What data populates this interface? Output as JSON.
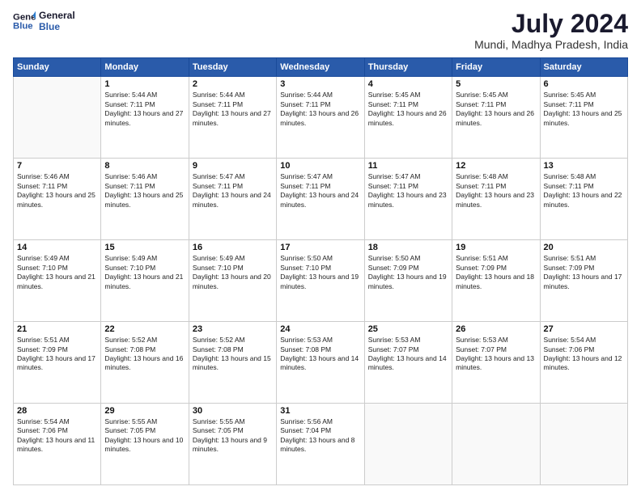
{
  "header": {
    "logo_line1": "General",
    "logo_line2": "Blue",
    "title": "July 2024",
    "subtitle": "Mundi, Madhya Pradesh, India"
  },
  "days_of_week": [
    "Sunday",
    "Monday",
    "Tuesday",
    "Wednesday",
    "Thursday",
    "Friday",
    "Saturday"
  ],
  "weeks": [
    [
      {
        "day": "",
        "sunrise": "",
        "sunset": "",
        "daylight": ""
      },
      {
        "day": "1",
        "sunrise": "Sunrise: 5:44 AM",
        "sunset": "Sunset: 7:11 PM",
        "daylight": "Daylight: 13 hours and 27 minutes."
      },
      {
        "day": "2",
        "sunrise": "Sunrise: 5:44 AM",
        "sunset": "Sunset: 7:11 PM",
        "daylight": "Daylight: 13 hours and 27 minutes."
      },
      {
        "day": "3",
        "sunrise": "Sunrise: 5:44 AM",
        "sunset": "Sunset: 7:11 PM",
        "daylight": "Daylight: 13 hours and 26 minutes."
      },
      {
        "day": "4",
        "sunrise": "Sunrise: 5:45 AM",
        "sunset": "Sunset: 7:11 PM",
        "daylight": "Daylight: 13 hours and 26 minutes."
      },
      {
        "day": "5",
        "sunrise": "Sunrise: 5:45 AM",
        "sunset": "Sunset: 7:11 PM",
        "daylight": "Daylight: 13 hours and 26 minutes."
      },
      {
        "day": "6",
        "sunrise": "Sunrise: 5:45 AM",
        "sunset": "Sunset: 7:11 PM",
        "daylight": "Daylight: 13 hours and 25 minutes."
      }
    ],
    [
      {
        "day": "7",
        "sunrise": "Sunrise: 5:46 AM",
        "sunset": "Sunset: 7:11 PM",
        "daylight": "Daylight: 13 hours and 25 minutes."
      },
      {
        "day": "8",
        "sunrise": "Sunrise: 5:46 AM",
        "sunset": "Sunset: 7:11 PM",
        "daylight": "Daylight: 13 hours and 25 minutes."
      },
      {
        "day": "9",
        "sunrise": "Sunrise: 5:47 AM",
        "sunset": "Sunset: 7:11 PM",
        "daylight": "Daylight: 13 hours and 24 minutes."
      },
      {
        "day": "10",
        "sunrise": "Sunrise: 5:47 AM",
        "sunset": "Sunset: 7:11 PM",
        "daylight": "Daylight: 13 hours and 24 minutes."
      },
      {
        "day": "11",
        "sunrise": "Sunrise: 5:47 AM",
        "sunset": "Sunset: 7:11 PM",
        "daylight": "Daylight: 13 hours and 23 minutes."
      },
      {
        "day": "12",
        "sunrise": "Sunrise: 5:48 AM",
        "sunset": "Sunset: 7:11 PM",
        "daylight": "Daylight: 13 hours and 23 minutes."
      },
      {
        "day": "13",
        "sunrise": "Sunrise: 5:48 AM",
        "sunset": "Sunset: 7:11 PM",
        "daylight": "Daylight: 13 hours and 22 minutes."
      }
    ],
    [
      {
        "day": "14",
        "sunrise": "Sunrise: 5:49 AM",
        "sunset": "Sunset: 7:10 PM",
        "daylight": "Daylight: 13 hours and 21 minutes."
      },
      {
        "day": "15",
        "sunrise": "Sunrise: 5:49 AM",
        "sunset": "Sunset: 7:10 PM",
        "daylight": "Daylight: 13 hours and 21 minutes."
      },
      {
        "day": "16",
        "sunrise": "Sunrise: 5:49 AM",
        "sunset": "Sunset: 7:10 PM",
        "daylight": "Daylight: 13 hours and 20 minutes."
      },
      {
        "day": "17",
        "sunrise": "Sunrise: 5:50 AM",
        "sunset": "Sunset: 7:10 PM",
        "daylight": "Daylight: 13 hours and 19 minutes."
      },
      {
        "day": "18",
        "sunrise": "Sunrise: 5:50 AM",
        "sunset": "Sunset: 7:09 PM",
        "daylight": "Daylight: 13 hours and 19 minutes."
      },
      {
        "day": "19",
        "sunrise": "Sunrise: 5:51 AM",
        "sunset": "Sunset: 7:09 PM",
        "daylight": "Daylight: 13 hours and 18 minutes."
      },
      {
        "day": "20",
        "sunrise": "Sunrise: 5:51 AM",
        "sunset": "Sunset: 7:09 PM",
        "daylight": "Daylight: 13 hours and 17 minutes."
      }
    ],
    [
      {
        "day": "21",
        "sunrise": "Sunrise: 5:51 AM",
        "sunset": "Sunset: 7:09 PM",
        "daylight": "Daylight: 13 hours and 17 minutes."
      },
      {
        "day": "22",
        "sunrise": "Sunrise: 5:52 AM",
        "sunset": "Sunset: 7:08 PM",
        "daylight": "Daylight: 13 hours and 16 minutes."
      },
      {
        "day": "23",
        "sunrise": "Sunrise: 5:52 AM",
        "sunset": "Sunset: 7:08 PM",
        "daylight": "Daylight: 13 hours and 15 minutes."
      },
      {
        "day": "24",
        "sunrise": "Sunrise: 5:53 AM",
        "sunset": "Sunset: 7:08 PM",
        "daylight": "Daylight: 13 hours and 14 minutes."
      },
      {
        "day": "25",
        "sunrise": "Sunrise: 5:53 AM",
        "sunset": "Sunset: 7:07 PM",
        "daylight": "Daylight: 13 hours and 14 minutes."
      },
      {
        "day": "26",
        "sunrise": "Sunrise: 5:53 AM",
        "sunset": "Sunset: 7:07 PM",
        "daylight": "Daylight: 13 hours and 13 minutes."
      },
      {
        "day": "27",
        "sunrise": "Sunrise: 5:54 AM",
        "sunset": "Sunset: 7:06 PM",
        "daylight": "Daylight: 13 hours and 12 minutes."
      }
    ],
    [
      {
        "day": "28",
        "sunrise": "Sunrise: 5:54 AM",
        "sunset": "Sunset: 7:06 PM",
        "daylight": "Daylight: 13 hours and 11 minutes."
      },
      {
        "day": "29",
        "sunrise": "Sunrise: 5:55 AM",
        "sunset": "Sunset: 7:05 PM",
        "daylight": "Daylight: 13 hours and 10 minutes."
      },
      {
        "day": "30",
        "sunrise": "Sunrise: 5:55 AM",
        "sunset": "Sunset: 7:05 PM",
        "daylight": "Daylight: 13 hours and 9 minutes."
      },
      {
        "day": "31",
        "sunrise": "Sunrise: 5:56 AM",
        "sunset": "Sunset: 7:04 PM",
        "daylight": "Daylight: 13 hours and 8 minutes."
      },
      {
        "day": "",
        "sunrise": "",
        "sunset": "",
        "daylight": ""
      },
      {
        "day": "",
        "sunrise": "",
        "sunset": "",
        "daylight": ""
      },
      {
        "day": "",
        "sunrise": "",
        "sunset": "",
        "daylight": ""
      }
    ]
  ]
}
